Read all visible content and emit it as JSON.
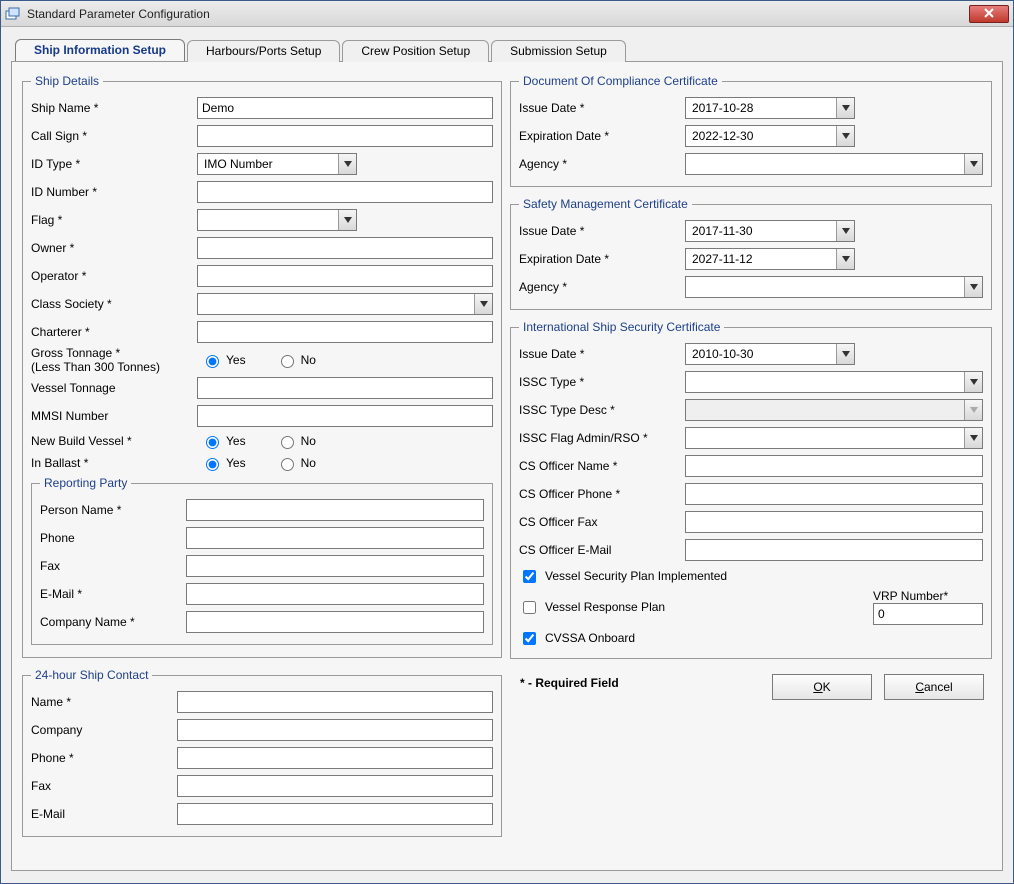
{
  "window": {
    "title": "Standard Parameter Configuration"
  },
  "tabs": {
    "t0": "Ship Information Setup",
    "t1": "Harbours/Ports Setup",
    "t2": "Crew Position Setup",
    "t3": "Submission Setup"
  },
  "shipDetails": {
    "legend": "Ship Details",
    "shipName": {
      "label": "Ship Name *",
      "value": "Demo"
    },
    "callSign": {
      "label": "Call Sign *",
      "value": ""
    },
    "idType": {
      "label": "ID Type *",
      "value": "IMO Number"
    },
    "idNumber": {
      "label": "ID Number *",
      "value": ""
    },
    "flag": {
      "label": "Flag *",
      "value": ""
    },
    "owner": {
      "label": "Owner *",
      "value": ""
    },
    "operator": {
      "label": "Operator *",
      "value": ""
    },
    "classSociety": {
      "label": "Class Society *",
      "value": ""
    },
    "charterer": {
      "label": "Charterer *",
      "value": ""
    },
    "grossTonnage": {
      "label1": "Gross Tonnage *",
      "label2": "(Less Than 300 Tonnes)",
      "yes": "Yes",
      "no": "No"
    },
    "vesselTonnage": {
      "label": "Vessel Tonnage",
      "value": ""
    },
    "mmsi": {
      "label": "MMSI Number",
      "value": ""
    },
    "newBuild": {
      "label": "New Build Vessel *",
      "yes": "Yes",
      "no": "No"
    },
    "inBallast": {
      "label": "In Ballast *",
      "yes": "Yes",
      "no": "No"
    }
  },
  "reportingParty": {
    "legend": "Reporting Party",
    "personName": {
      "label": "Person Name *",
      "value": ""
    },
    "phone": {
      "label": "Phone",
      "value": ""
    },
    "fax": {
      "label": "Fax",
      "value": ""
    },
    "email": {
      "label": "E-Mail *",
      "value": ""
    },
    "company": {
      "label": "Company Name *",
      "value": ""
    }
  },
  "shipContact": {
    "legend": "24-hour Ship Contact",
    "name": {
      "label": "Name *",
      "value": ""
    },
    "company": {
      "label": "Company",
      "value": ""
    },
    "phone": {
      "label": "Phone *",
      "value": ""
    },
    "fax": {
      "label": "Fax",
      "value": ""
    },
    "email": {
      "label": "E-Mail",
      "value": ""
    }
  },
  "doc": {
    "legend": "Document Of Compliance Certificate",
    "issue": {
      "label": "Issue Date *",
      "value": "2017-10-28"
    },
    "exp": {
      "label": "Expiration Date *",
      "value": "2022-12-30"
    },
    "agency": {
      "label": "Agency *",
      "value": ""
    }
  },
  "smc": {
    "legend": "Safety Management Certificate",
    "issue": {
      "label": "Issue Date *",
      "value": "2017-11-30"
    },
    "exp": {
      "label": "Expiration Date *",
      "value": "2027-11-12"
    },
    "agency": {
      "label": "Agency *",
      "value": ""
    }
  },
  "issc": {
    "legend": "International Ship Security Certificate",
    "issue": {
      "label": "Issue Date *",
      "value": "2010-10-30"
    },
    "type": {
      "label": "ISSC Type *",
      "value": ""
    },
    "typeDesc": {
      "label": "ISSC Type Desc *",
      "value": ""
    },
    "flagAdmin": {
      "label": "ISSC Flag Admin/RSO *",
      "value": ""
    },
    "csName": {
      "label": "CS Officer Name *",
      "value": ""
    },
    "csPhone": {
      "label": "CS Officer Phone *",
      "value": ""
    },
    "csFax": {
      "label": "CS Officer Fax",
      "value": ""
    },
    "csEmail": {
      "label": "CS Officer E-Mail",
      "value": ""
    },
    "vspi": {
      "label": "Vessel Security Plan Implemented",
      "checked": true
    },
    "vrp": {
      "label": "Vessel Response Plan",
      "checked": false,
      "numLabel": "VRP Number*",
      "numValue": "0"
    },
    "cvssa": {
      "label": "CVSSA Onboard",
      "checked": true
    }
  },
  "footer": {
    "required": "* - Required Field",
    "ok": "OK",
    "cancel": "Cancel"
  }
}
